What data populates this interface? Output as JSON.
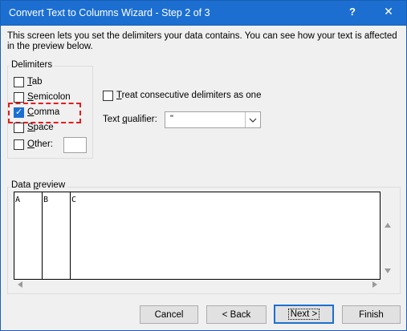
{
  "window": {
    "title": "Convert Text to Columns Wizard - Step 2 of 3",
    "help_glyph": "?",
    "close_glyph": "✕"
  },
  "description": "This screen lets you set the delimiters your data contains.  You can see how your text is affected in the preview below.",
  "delimiters": {
    "legend": "Delimiters",
    "tab": {
      "label_key": "T",
      "label_rest": "ab",
      "checked": false
    },
    "semicolon": {
      "label_key": "S",
      "label_rest": "emicolon",
      "checked": false
    },
    "comma": {
      "label_key": "C",
      "label_rest": "omma",
      "checked": true
    },
    "space": {
      "label_key": "S",
      "label_rest": "pace",
      "checked": false
    },
    "other": {
      "label_key": "O",
      "label_rest": "ther:",
      "checked": false,
      "value": ""
    }
  },
  "consecutive": {
    "label_key": "T",
    "label_rest": "reat consecutive delimiters as one",
    "checked": false
  },
  "qualifier": {
    "label_pre": "Text ",
    "label_key": "q",
    "label_rest": "ualifier:",
    "value": "\""
  },
  "preview": {
    "legend_pre": "Data ",
    "legend_key": "p",
    "legend_rest": "review",
    "columns": [
      "A",
      "B",
      "C"
    ]
  },
  "buttons": {
    "cancel": "Cancel",
    "back": "< Back",
    "next": "Next >",
    "finish": "Finish",
    "back_key": "B",
    "next_key": "N",
    "finish_key": "F"
  },
  "colors": {
    "accent": "#1c6fd1",
    "highlight": "#e31d1d",
    "dialog_bg": "#f0f0f0"
  }
}
